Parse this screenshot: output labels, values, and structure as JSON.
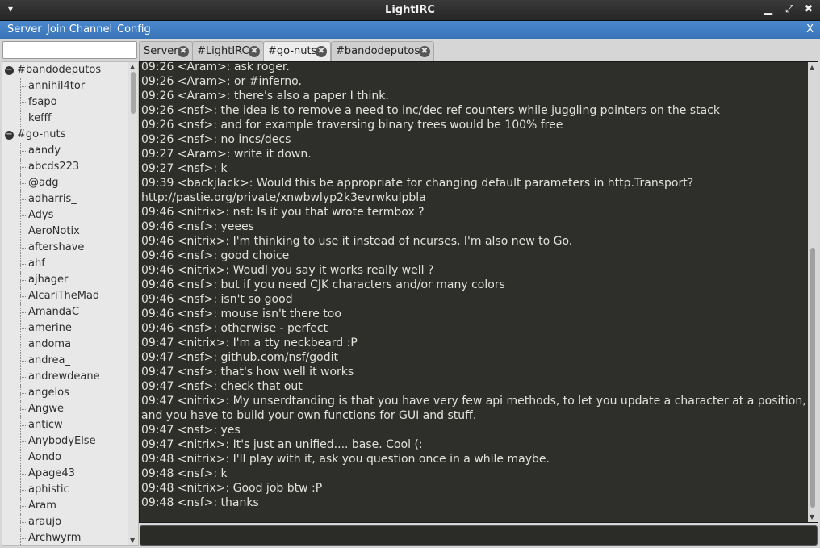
{
  "window": {
    "title": "LightIRC",
    "menu_arrow": "▾",
    "minimize": "▁",
    "maximize": "⤢",
    "close": "✖"
  },
  "menubar": {
    "server": "Server",
    "join_channel": "Join Channel",
    "config": "Config",
    "close_x": "X"
  },
  "channel_filter": {
    "value": "",
    "placeholder": ""
  },
  "tabs": [
    {
      "label": "Server",
      "close_icon": "✖"
    },
    {
      "label": "#LightIRC",
      "close_icon": "✖"
    },
    {
      "label": "#go-nuts",
      "close_icon": "✖"
    },
    {
      "label": "#bandodeputos",
      "close_icon": "✖"
    }
  ],
  "tree": [
    {
      "type": "channel",
      "label": "#bandodeputos",
      "toggle": "−"
    },
    {
      "type": "user",
      "label": "annihil4tor"
    },
    {
      "type": "user",
      "label": "fsapo"
    },
    {
      "type": "user",
      "label": "kefff"
    },
    {
      "type": "channel",
      "label": "#go-nuts",
      "toggle": "−"
    },
    {
      "type": "user",
      "label": "aandy"
    },
    {
      "type": "user",
      "label": "abcds223"
    },
    {
      "type": "user",
      "label": "@adg"
    },
    {
      "type": "user",
      "label": "adharris_"
    },
    {
      "type": "user",
      "label": "Adys"
    },
    {
      "type": "user",
      "label": "AeroNotix"
    },
    {
      "type": "user",
      "label": "aftershave"
    },
    {
      "type": "user",
      "label": "ahf"
    },
    {
      "type": "user",
      "label": "ajhager"
    },
    {
      "type": "user",
      "label": "AlcariTheMad"
    },
    {
      "type": "user",
      "label": "AmandaC"
    },
    {
      "type": "user",
      "label": "amerine"
    },
    {
      "type": "user",
      "label": "andoma"
    },
    {
      "type": "user",
      "label": "andrea_"
    },
    {
      "type": "user",
      "label": "andrewdeane"
    },
    {
      "type": "user",
      "label": "angelos"
    },
    {
      "type": "user",
      "label": "Angwe"
    },
    {
      "type": "user",
      "label": "anticw"
    },
    {
      "type": "user",
      "label": "AnybodyElse"
    },
    {
      "type": "user",
      "label": "Aondo"
    },
    {
      "type": "user",
      "label": "Apage43"
    },
    {
      "type": "user",
      "label": "aphistic"
    },
    {
      "type": "user",
      "label": "Aram"
    },
    {
      "type": "user",
      "label": "araujo"
    },
    {
      "type": "user",
      "label": "Archwyrm"
    }
  ],
  "chat": [
    "09:26 <Aram>: ask roger.",
    "09:26 <Aram>: or #inferno.",
    "09:26 <Aram>: there's also a paper I think.",
    "09:26 <nsf>: the idea is to remove a need to inc/dec ref counters while juggling pointers on the stack",
    "09:26 <nsf>: and for example traversing binary trees would be 100% free",
    "09:26 <nsf>: no incs/decs",
    "09:27 <Aram>: write it down.",
    "09:27 <nsf>: k",
    "09:39 <backjlack>: Would this be appropriate for changing default parameters in http.Transport? http://pastie.org/private/xnwbwlyp2k3evrwkulpbla",
    "09:46 <nitrix>: nsf: Is it you that wrote termbox ?",
    "09:46 <nsf>: yeees",
    "09:46 <nitrix>: I'm thinking to use it instead of ncurses, I'm also new to Go.",
    "09:46 <nsf>: good choice",
    "09:46 <nitrix>: Woudl you say it works really well ?",
    "09:46 <nsf>: but if you need CJK characters and/or many colors",
    "09:46 <nsf>: isn't so good",
    "09:46 <nsf>: mouse isn't there too",
    "09:46 <nsf>: otherwise - perfect",
    "09:47 <nitrix>: I'm a tty neckbeard :P",
    "09:47 <nsf>: github.com/nsf/godit",
    "09:47 <nsf>: that's how well it works",
    "09:47 <nsf>: check that out",
    "09:47 <nitrix>: My unserdtanding is that you have very few api methods, to let you update a character at a position, and you have to build your own functions for GUI and stuff.",
    "09:47 <nsf>: yes",
    "09:47 <nitrix>: It's just an unified.... base. Cool (:",
    "09:48 <nitrix>: I'll play with it, ask you question once in a while maybe.",
    "09:48 <nsf>: k",
    "09:48 <nitrix>: Good job btw :P",
    "09:48 <nsf>: thanks"
  ],
  "message_input": {
    "value": "",
    "placeholder": ""
  },
  "scroll": {
    "up": "▲",
    "down": "▼"
  }
}
